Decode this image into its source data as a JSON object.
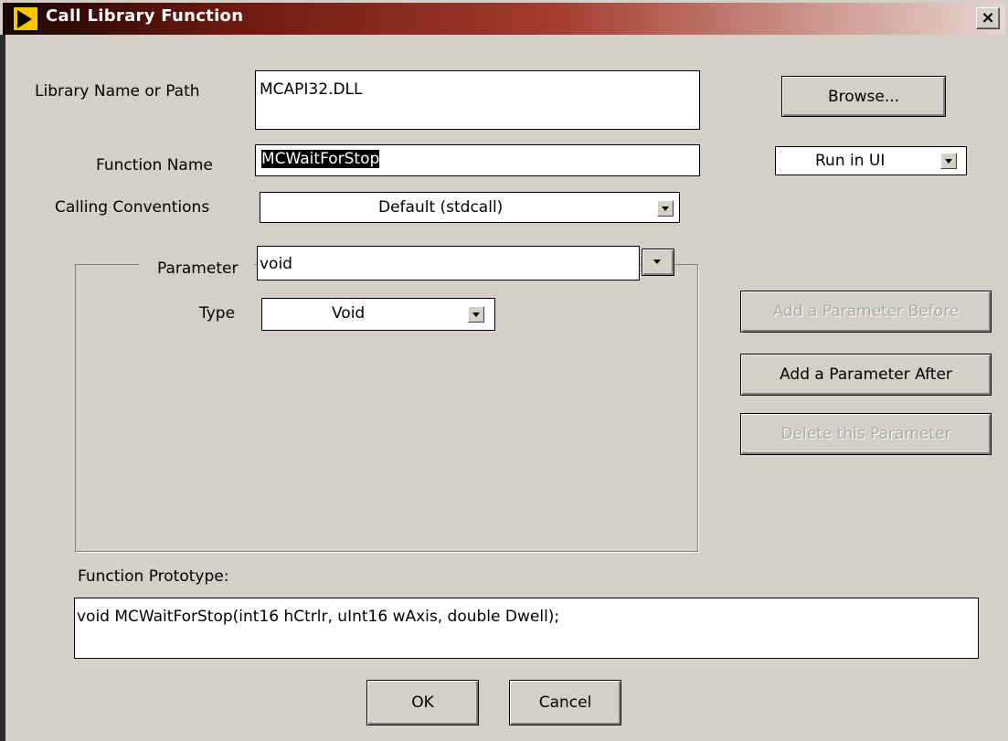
{
  "window": {
    "title": "Call Library Function",
    "close_label": "×"
  },
  "library": {
    "label": "Library Name or Path",
    "value": "MCAPI32.DLL",
    "browse_label": "Browse..."
  },
  "function": {
    "label": "Function Name",
    "value": "MCWaitForStop",
    "run_mode": "Run in UI"
  },
  "calling": {
    "label": "Calling Conventions",
    "value": "Default (stdcall)"
  },
  "parameter": {
    "label": "Parameter",
    "value": "void",
    "type_label": "Type",
    "type_value": "Void"
  },
  "buttons": {
    "add_before": "Add a Parameter Before",
    "add_after": "Add a Parameter After",
    "delete": "Delete this Parameter",
    "ok": "OK",
    "cancel": "Cancel"
  },
  "prototype": {
    "label": "Function Prototype:",
    "value": "void MCWaitForStop(int16 hCtrlr, uInt16 wAxis, double Dwell);"
  }
}
